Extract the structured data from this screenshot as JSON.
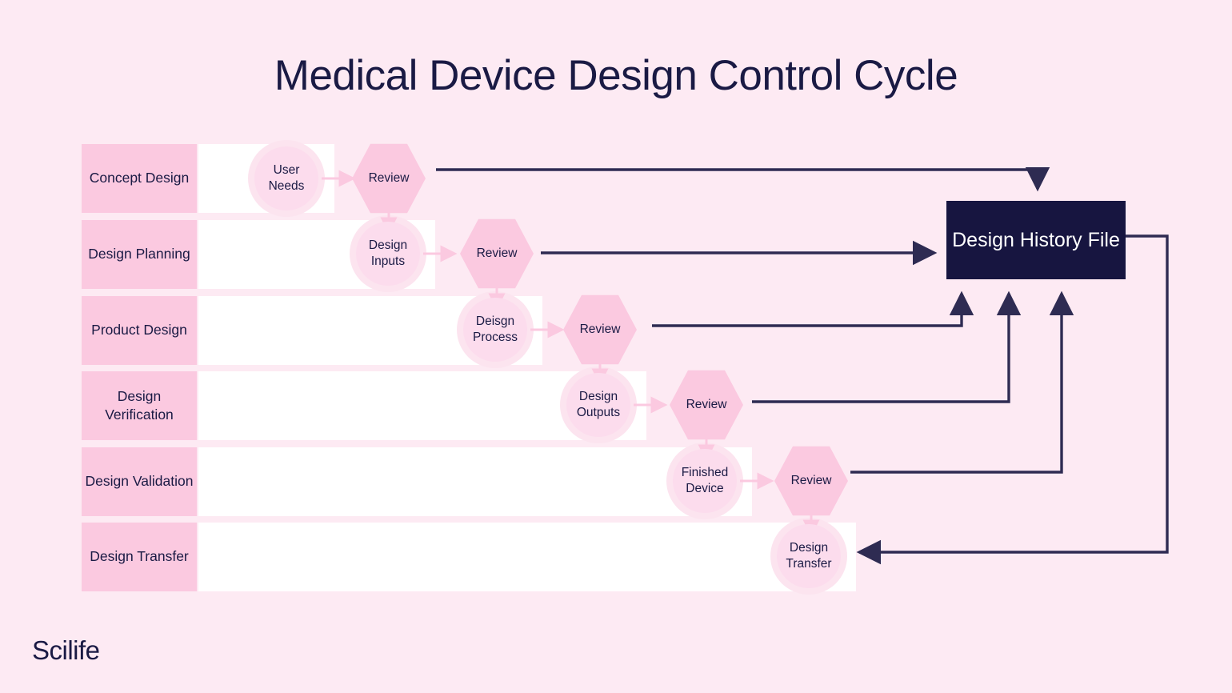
{
  "page": {
    "title": "Medical Device Design Control Cycle",
    "logo": "Scilife",
    "background_color": "#fdeaf3",
    "accent_dark": "#171540",
    "accent_pink": "#fbc9e0",
    "accent_pink_light": "#fcdced",
    "band_color": "#ffffff"
  },
  "stages": [
    {
      "label": "Concept Design",
      "node": "User Needs",
      "review": "Review"
    },
    {
      "label": "Design Planning",
      "node": "Design Inputs",
      "review": "Review"
    },
    {
      "label": "Product Design",
      "node": "Deisgn Process",
      "review": "Review"
    },
    {
      "label": "Design Verification",
      "node": "Design Outputs",
      "review": "Review"
    },
    {
      "label": "Design Validation",
      "node": "Finished Device",
      "review": "Review"
    },
    {
      "label": "Design Transfer",
      "node": "Design Transfer",
      "review": null
    }
  ],
  "output": {
    "label": "Design History File"
  }
}
